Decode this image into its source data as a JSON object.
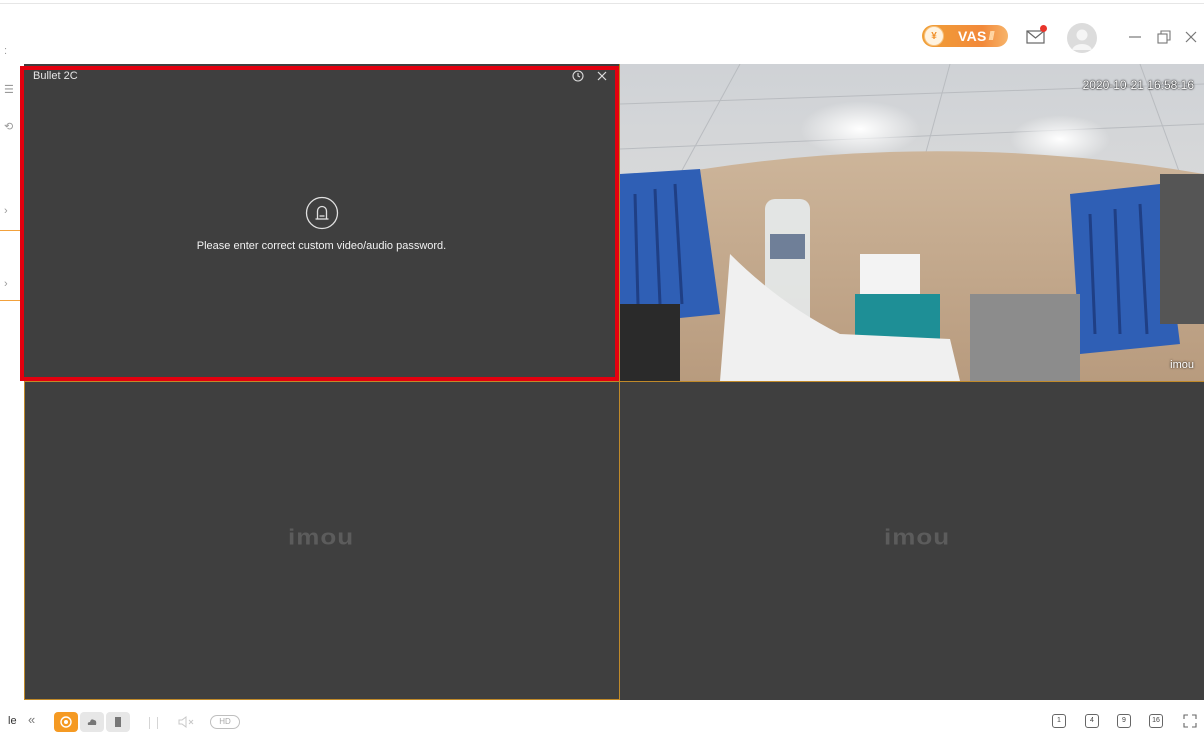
{
  "header": {
    "vas_label": "VAS",
    "vas_coin": "¥"
  },
  "sidebar": {
    "glyphs": [
      ":",
      "☰",
      "⟲",
      "›",
      "›"
    ]
  },
  "panes": [
    {
      "camera_name": "Bullet 2C",
      "message": "Please enter correct custom video/audio password.",
      "selected": true
    },
    {
      "timestamp": "2020-10-21 16:58:16",
      "watermark": "imou"
    },
    {
      "logo": "imou"
    },
    {
      "logo": "imou"
    }
  ],
  "bottombar": {
    "left_text": "le",
    "collapse": "«",
    "hd_label": "HD",
    "layouts": [
      "1",
      "4",
      "9",
      "16"
    ]
  },
  "colors": {
    "accent": "#f59a23",
    "selection": "#e3000f",
    "pane_bg": "#3f3f3f"
  }
}
